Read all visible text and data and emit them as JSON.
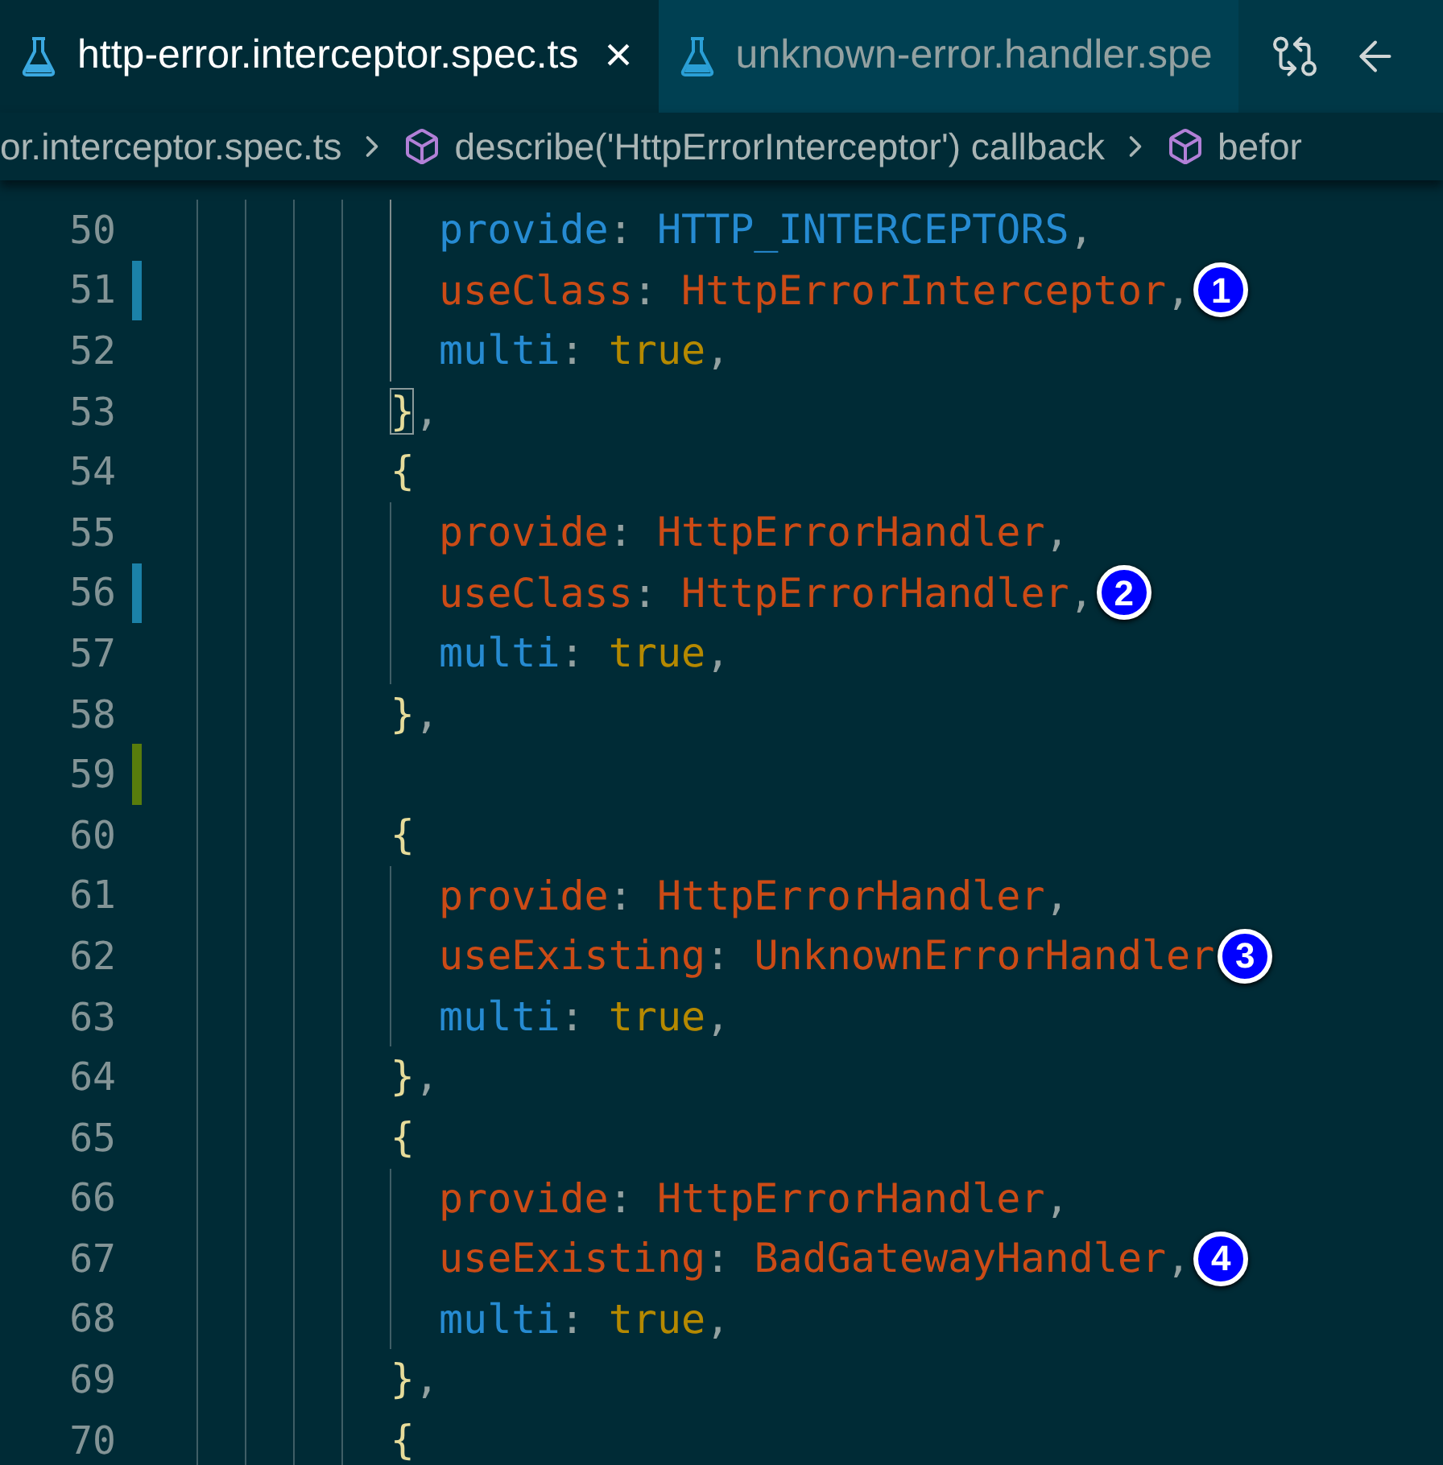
{
  "tabs": [
    {
      "label": "http-error.interceptor.spec.ts",
      "selected": true,
      "close": "×"
    },
    {
      "label": "unknown-error.handler.spe",
      "selected": false
    }
  ],
  "breadcrumb": [
    {
      "label": "or.interceptor.spec.ts",
      "kind": "file"
    },
    {
      "label": "describe('HttpErrorInterceptor') callback",
      "kind": "symbol"
    },
    {
      "label": "befor",
      "kind": "symbol"
    }
  ],
  "lines": [
    {
      "number": "50",
      "modified": false,
      "added": false,
      "inner": true,
      "tokens": [
        {
          "kind": "property",
          "text": "provide"
        },
        {
          "kind": "punct",
          "text": ": "
        },
        {
          "kind": "constant",
          "text": "HTTP_INTERCEPTORS"
        },
        {
          "kind": "punct",
          "text": ","
        }
      ]
    },
    {
      "number": "51",
      "modified": true,
      "added": false,
      "inner": true,
      "tokens": [
        {
          "kind": "key",
          "text": "useClass"
        },
        {
          "kind": "punct",
          "text": ": "
        },
        {
          "kind": "class",
          "text": "HttpErrorInterceptor"
        },
        {
          "kind": "punct",
          "text": ","
        }
      ],
      "marker": "1"
    },
    {
      "number": "52",
      "modified": false,
      "added": false,
      "inner": true,
      "tokens": [
        {
          "kind": "property",
          "text": "multi"
        },
        {
          "kind": "punct",
          "text": ": "
        },
        {
          "kind": "boolean",
          "text": "true"
        },
        {
          "kind": "punct",
          "text": ","
        }
      ]
    },
    {
      "number": "53",
      "modified": false,
      "added": false,
      "inner": false,
      "tokens": [
        {
          "kind": "brace",
          "text": "}",
          "matched": true
        },
        {
          "kind": "punct",
          "text": ","
        }
      ]
    },
    {
      "number": "54",
      "modified": false,
      "added": false,
      "inner": false,
      "tokens": [
        {
          "kind": "brace",
          "text": "{",
          "matched": false
        }
      ]
    },
    {
      "number": "55",
      "modified": false,
      "added": false,
      "inner": true,
      "tokens": [
        {
          "kind": "key",
          "text": "provide"
        },
        {
          "kind": "punct",
          "text": ": "
        },
        {
          "kind": "class",
          "text": "HttpErrorHandler"
        },
        {
          "kind": "punct",
          "text": ","
        }
      ]
    },
    {
      "number": "56",
      "modified": true,
      "added": false,
      "inner": true,
      "tokens": [
        {
          "kind": "key",
          "text": "useClass"
        },
        {
          "kind": "punct",
          "text": ": "
        },
        {
          "kind": "class",
          "text": "HttpErrorHandler"
        },
        {
          "kind": "punct",
          "text": ","
        }
      ],
      "marker": "2"
    },
    {
      "number": "57",
      "modified": false,
      "added": false,
      "inner": true,
      "tokens": [
        {
          "kind": "property",
          "text": "multi"
        },
        {
          "kind": "punct",
          "text": ": "
        },
        {
          "kind": "boolean",
          "text": "true"
        },
        {
          "kind": "punct",
          "text": ","
        }
      ]
    },
    {
      "number": "58",
      "modified": false,
      "added": false,
      "inner": false,
      "tokens": [
        {
          "kind": "brace",
          "text": "}",
          "matched": false
        },
        {
          "kind": "punct",
          "text": ","
        }
      ]
    },
    {
      "number": "59",
      "modified": false,
      "added": true,
      "inner": false
    },
    {
      "number": "60",
      "modified": false,
      "added": false,
      "inner": false,
      "tokens": [
        {
          "kind": "brace",
          "text": "{",
          "matched": false
        }
      ]
    },
    {
      "number": "61",
      "modified": false,
      "added": false,
      "inner": true,
      "tokens": [
        {
          "kind": "key",
          "text": "provide"
        },
        {
          "kind": "punct",
          "text": ": "
        },
        {
          "kind": "class",
          "text": "HttpErrorHandler"
        },
        {
          "kind": "punct",
          "text": ","
        }
      ]
    },
    {
      "number": "62",
      "modified": false,
      "added": false,
      "inner": true,
      "tokens": [
        {
          "kind": "key",
          "text": "useExisting"
        },
        {
          "kind": "punct",
          "text": ": "
        },
        {
          "kind": "class",
          "text": "UnknownErrorHandler"
        }
      ],
      "marker": "3"
    },
    {
      "number": "63",
      "modified": false,
      "added": false,
      "inner": true,
      "tokens": [
        {
          "kind": "property",
          "text": "multi"
        },
        {
          "kind": "punct",
          "text": ": "
        },
        {
          "kind": "boolean",
          "text": "true"
        },
        {
          "kind": "punct",
          "text": ","
        }
      ]
    },
    {
      "number": "64",
      "modified": false,
      "added": false,
      "inner": false,
      "tokens": [
        {
          "kind": "brace",
          "text": "}",
          "matched": false
        },
        {
          "kind": "punct",
          "text": ","
        }
      ]
    },
    {
      "number": "65",
      "modified": false,
      "added": false,
      "inner": false,
      "tokens": [
        {
          "kind": "brace",
          "text": "{",
          "matched": false
        }
      ]
    },
    {
      "number": "66",
      "modified": false,
      "added": false,
      "inner": true,
      "tokens": [
        {
          "kind": "key",
          "text": "provide"
        },
        {
          "kind": "punct",
          "text": ": "
        },
        {
          "kind": "class",
          "text": "HttpErrorHandler"
        },
        {
          "kind": "punct",
          "text": ","
        }
      ]
    },
    {
      "number": "67",
      "modified": false,
      "added": false,
      "inner": true,
      "tokens": [
        {
          "kind": "key",
          "text": "useExisting"
        },
        {
          "kind": "punct",
          "text": ": "
        },
        {
          "kind": "class",
          "text": "BadGatewayHandler"
        },
        {
          "kind": "punct",
          "text": ","
        }
      ],
      "marker": "4"
    },
    {
      "number": "68",
      "modified": false,
      "added": false,
      "inner": true,
      "tokens": [
        {
          "kind": "property",
          "text": "multi"
        },
        {
          "kind": "punct",
          "text": ": "
        },
        {
          "kind": "boolean",
          "text": "true"
        },
        {
          "kind": "punct",
          "text": ","
        }
      ]
    },
    {
      "number": "69",
      "modified": false,
      "added": false,
      "inner": false,
      "tokens": [
        {
          "kind": "brace",
          "text": "}",
          "matched": false
        },
        {
          "kind": "punct",
          "text": ","
        }
      ]
    },
    {
      "number": "70",
      "modified": false,
      "added": false,
      "inner": false,
      "tokens": [
        {
          "kind": "brace",
          "text": "{",
          "matched": false
        }
      ]
    }
  ]
}
